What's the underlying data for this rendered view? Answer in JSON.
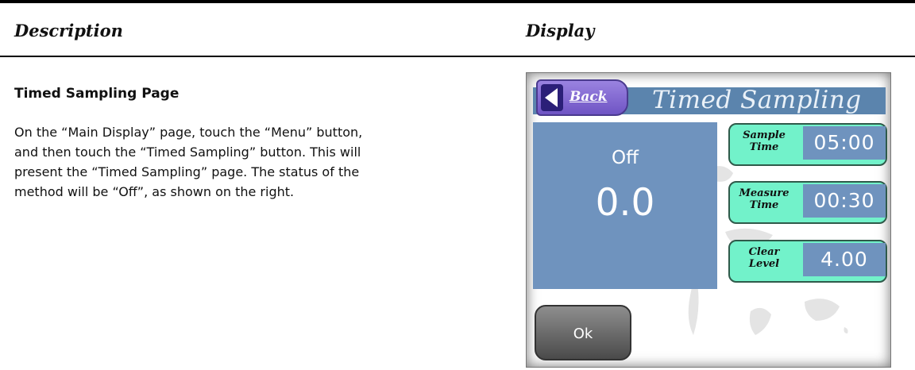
{
  "columns": {
    "description": "Description",
    "display": "Display"
  },
  "section": {
    "title": "Timed Sampling Page",
    "body": "On the “Main Display” page, touch the “Menu” button, and then touch the “Timed Sampling” button.  This will present the “Timed Sampling” page.  The status of the method will be “Off”, as shown on the right."
  },
  "screen": {
    "back_label": "Back",
    "title": "Timed Sampling",
    "status": "Off",
    "value": "0.0",
    "params": [
      {
        "label_line1": "Sample",
        "label_line2": "Time",
        "value": "05:00"
      },
      {
        "label_line1": "Measure",
        "label_line2": "Time",
        "value": "00:30"
      },
      {
        "label_line1": "Clear",
        "label_line2": "Level",
        "value": "4.00"
      }
    ],
    "ok_label": "Ok"
  },
  "colors": {
    "titlebar": "#5b84ad",
    "panel": "#6f93be",
    "param_button": "#72f2ca",
    "back_button": "#8a6fd6"
  }
}
